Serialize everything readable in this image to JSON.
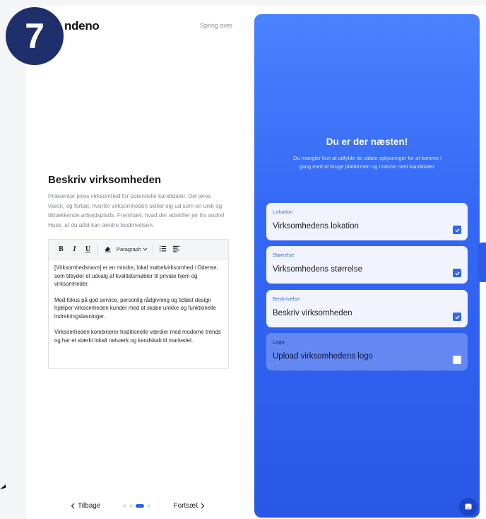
{
  "step_badge": "7",
  "logo": "ndeno",
  "skip_label": "Spring over",
  "left": {
    "title": "Beskriv virksomheden",
    "description": "Præsenter jeres virksomhed for potentielle kandidater. Del jeres vision, og fortæl, hvorfor virksomheden skiller sig ud som en unik og tiltrækkende arbejdsplads. Fremhæv, hvad der adskiller jer fra andre! Husk, at du altid kan ændre beskrivelsen.",
    "toolbar": {
      "bold": "B",
      "italic": "I",
      "underline": "U",
      "paragraph": "Paragraph"
    },
    "editor_paragraphs": [
      "[Virksomhedsnavn] er en mindre, lokal møbelvirksomhed i Odense, som tilbyder et udvalg af kvalitetsmøbler til private hjem og virksomheder.",
      "Med fokus på god service, personlig rådgivning og tidløst design hjælper virksomheden kunder med at skabe unikke og funktionelle indretningsløsninger.",
      "Virksomheden kombinerer traditionelle værdier med moderne trends og har et stærkt lokalt netværk og kendskab til markedet."
    ],
    "back_label": "Tilbage",
    "next_label": "Fortsæt",
    "progress_dots": 4,
    "progress_active_index": 2
  },
  "right": {
    "title": "Du er der næsten!",
    "subtitle": "Du mangler kun at udfylde de sidste oplysninger for at komme i gang med at bruge platformen og matche med kandidater.",
    "items": [
      {
        "small": "Lokation",
        "main": "Virksomhedens lokation",
        "checked": true
      },
      {
        "small": "Størrelse",
        "main": "Virksomhedens størrelse",
        "checked": true
      },
      {
        "small": "Beskrivelse",
        "main": "Beskriv virksomheden",
        "checked": true
      },
      {
        "small": "Logo",
        "main": "Upload virksomhedens logo",
        "checked": false
      }
    ]
  },
  "colors": {
    "accent": "#2f66ef",
    "badge": "#1e2f6b"
  }
}
